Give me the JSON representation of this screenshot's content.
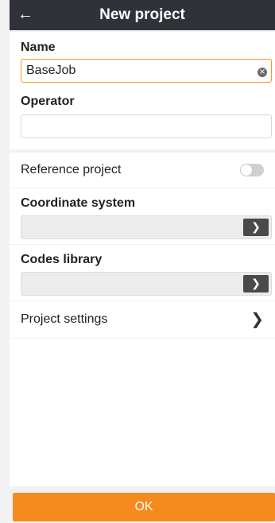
{
  "header": {
    "title": "New project",
    "back_icon": "back-arrow-icon"
  },
  "form": {
    "name": {
      "label": "Name",
      "value": "BaseJob",
      "clear_icon": "clear-icon"
    },
    "operator": {
      "label": "Operator",
      "value": ""
    },
    "reference_project": {
      "label": "Reference project",
      "enabled": false
    },
    "coordinate_system": {
      "label": "Coordinate system",
      "value": "",
      "button_icon": "chevron-right-icon"
    },
    "codes_library": {
      "label": "Codes library",
      "value": "",
      "button_icon": "chevron-right-icon"
    },
    "project_settings": {
      "label": "Project settings",
      "icon": "chevron-right-icon"
    }
  },
  "footer": {
    "ok_label": "OK"
  },
  "colors": {
    "header_bg": "#2f3238",
    "accent": "#f58a1f"
  }
}
